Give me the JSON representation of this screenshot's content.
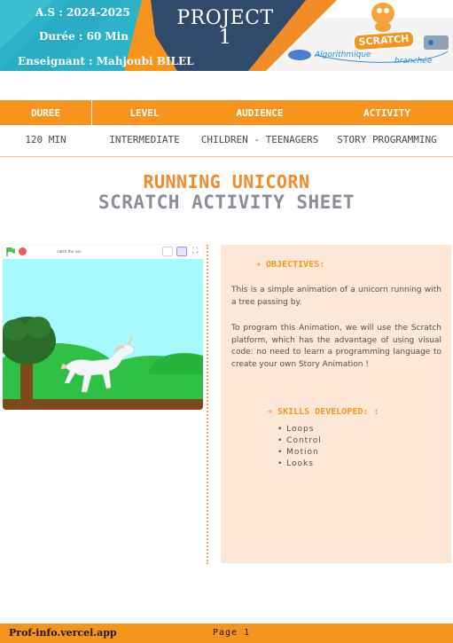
{
  "header": {
    "school_year": "A.S : 2024-2025",
    "duration": "Durée : 60 Min",
    "teacher": "Enseignant : Mahjoubi BILEL",
    "project_line1": "PROJECT",
    "project_line2": "1",
    "logo_text": "SCRATCH",
    "tagline_1": "Algorithmique",
    "tagline_2": "branchée",
    "colors": {
      "teal": "#29b0c7",
      "navy": "#2f4a6b",
      "orange": "#f7941d"
    }
  },
  "info_table": {
    "headers": [
      "DUREE",
      "LEVEL",
      "AUDIENCE",
      "ACTIVITY"
    ],
    "values": [
      "120 MIN",
      "INTERMEDIATE",
      "CHILDREN - TEENAGERS",
      "STORY PROGRAMMING"
    ]
  },
  "title": {
    "line1": "RUNNING UNICORN",
    "line2": "SCRATCH ACTIVITY SHEET"
  },
  "stage": {
    "project_name": "catch the sun",
    "icons": [
      "green-flag-icon",
      "stop-icon",
      "small-stage-icon",
      "normal-stage-icon",
      "fullscreen-icon"
    ]
  },
  "objectives": {
    "heading": "➔ OBJECTIVES:",
    "paragraph1": "This is a simple animation of a unicorn running with a tree passing by.",
    "paragraph2": "To program this Animation, we will use the Scratch platform, which has the advantage of using visual code: no need to learn a programming language to create your own Story Animation !"
  },
  "skills": {
    "heading": "➔ SKILLS DEVELOPED: :",
    "items": [
      "Loops",
      "Control",
      "Motion",
      "Looks"
    ]
  },
  "footer": {
    "site": "Prof-info.vercel.app",
    "page": "Page 1"
  }
}
